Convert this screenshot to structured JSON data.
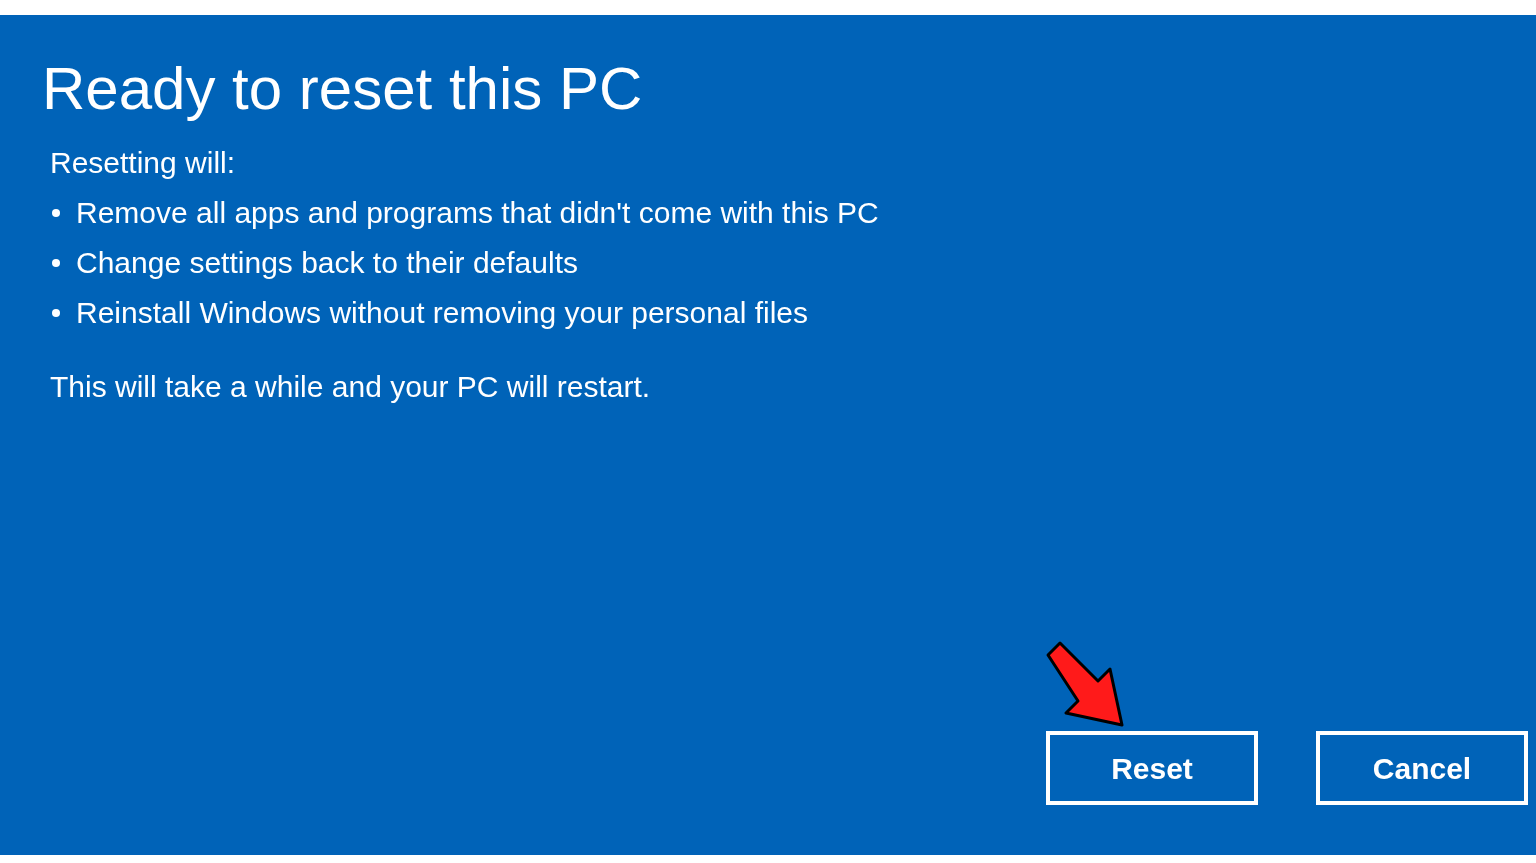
{
  "title": "Ready to reset this PC",
  "intro": "Resetting will:",
  "items": [
    "Remove all apps and programs that didn't come with this PC",
    "Change settings back to their defaults",
    "Reinstall Windows without removing your personal files"
  ],
  "note": "This will take a while and your PC will restart.",
  "buttons": [
    "Reset",
    "Cancel"
  ]
}
